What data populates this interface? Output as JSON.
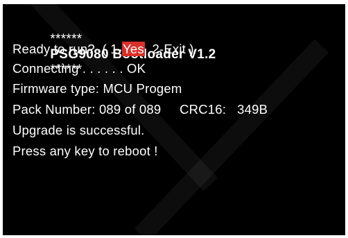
{
  "colors": {
    "screen_background": "#000000",
    "text": "#ffffff",
    "selection_highlight": "#d9302a"
  },
  "header": {
    "stars_left": "******",
    "title": "PSG9080 Bootloader V1.2",
    "stars_right": "******"
  },
  "prompt": {
    "question": "Ready to run?",
    "open_paren": "( 1-",
    "option1_label": "Yes",
    "option2_label": "2-Exit )"
  },
  "status": {
    "connecting": "Connecting . . . . . . OK",
    "firmware": "Firmware type: MCU Progem",
    "pack": "Pack Number: 089 of 089",
    "crc": "CRC16:   349B",
    "result": "Upgrade is successful.",
    "reboot": "Press any key to reboot !"
  }
}
